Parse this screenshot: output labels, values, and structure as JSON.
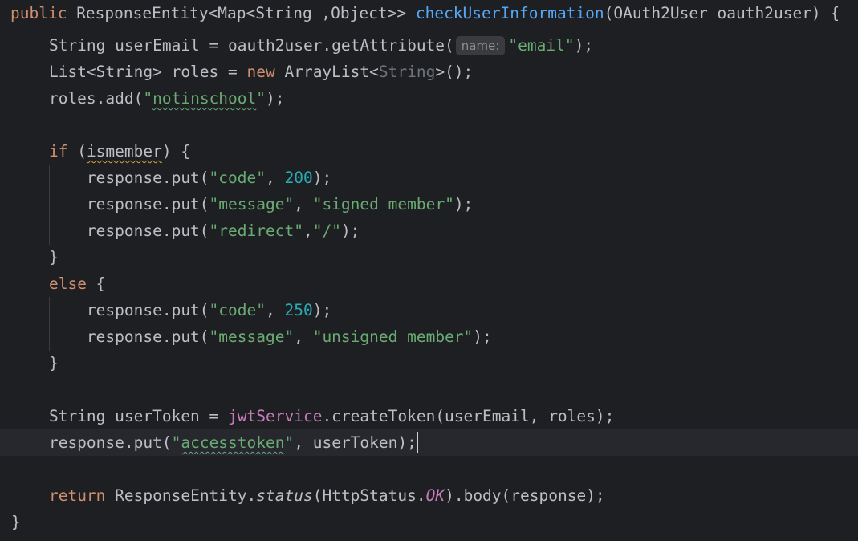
{
  "editor": {
    "lines": {
      "l1": {
        "a": "public",
        "b": " ResponseEntity<Map<String ,Object>> ",
        "c": "checkUserInformation",
        "d": "(OAuth2User oauth2user) {"
      },
      "l2": {
        "a": "    String userEmail = oauth2user.getAttribute(",
        "hint": "name:",
        "b": "\"email\"",
        "c": ");"
      },
      "l3": {
        "a": "    List<String> roles = ",
        "b": "new",
        "c": " ArrayList<",
        "d": "String",
        "e": ">();"
      },
      "l4": {
        "a": "    roles.add(",
        "b": "\"",
        "c": "notinschool",
        "d": "\"",
        "e": ");"
      },
      "l6": {
        "a": "    ",
        "b": "if",
        "c": " (",
        "d": "ismember",
        "e": ") {"
      },
      "l7": {
        "a": "        response.put(",
        "b": "\"code\"",
        "c": ", ",
        "d": "200",
        "e": ");"
      },
      "l8": {
        "a": "        response.put(",
        "b": "\"message\"",
        "c": ", ",
        "d": "\"signed member\"",
        "e": ");"
      },
      "l9": {
        "a": "        response.put(",
        "b": "\"redirect\"",
        "c": ",",
        "d": "\"/\"",
        "e": ");"
      },
      "l10": {
        "a": "    }"
      },
      "l11": {
        "a": "    ",
        "b": "else",
        "c": " {"
      },
      "l12": {
        "a": "        response.put(",
        "b": "\"code\"",
        "c": ", ",
        "d": "250",
        "e": ");"
      },
      "l13": {
        "a": "        response.put(",
        "b": "\"message\"",
        "c": ", ",
        "d": "\"unsigned member\"",
        "e": ");"
      },
      "l14": {
        "a": "    }"
      },
      "l16": {
        "a": "    String userToken = ",
        "b": "jwtService",
        "c": ".createToken(userEmail, roles);"
      },
      "l17": {
        "a": "    response.put(",
        "b": "\"",
        "c": "accesstoken",
        "d": "\"",
        "e": ", userToken);"
      },
      "l19": {
        "a": "    ",
        "b": "return",
        "c": " ResponseEntity.",
        "d": "status",
        "e": "(HttpStatus.",
        "f": "OK",
        "g": ").body(response);"
      },
      "l20": {
        "a": "}"
      }
    }
  }
}
